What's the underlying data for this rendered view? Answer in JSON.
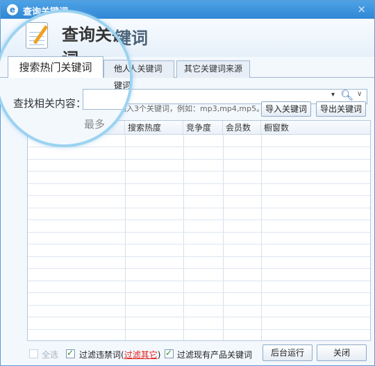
{
  "window": {
    "title": "查询关键词",
    "close_glyph": "×",
    "header_title": "查询关键词"
  },
  "tabs": [
    {
      "label": "搜索热门关键词",
      "active": true
    },
    {
      "label": "他人关键词",
      "active": false
    },
    {
      "label": "其它关键词来源",
      "active": false
    }
  ],
  "search": {
    "label": "查找相关内容：",
    "input_value": "",
    "hint": "输入3个关键词，例如：mp3,mp4,mp5。",
    "max_hint": "最多",
    "dropdown_glyph": "▾",
    "search_icon": "search-icon",
    "chevron_icon": "chevron-down-icon"
  },
  "buttons": {
    "import": "导入关键词",
    "export": "导出关键词",
    "background_run": "后台运行",
    "close": "关闭"
  },
  "table": {
    "columns": [
      "",
      "搜索热度",
      "竞争度",
      "会员数",
      "橱窗数"
    ],
    "rows": []
  },
  "footer": {
    "select_all": "全选",
    "filter_banned": "过滤违禁词(",
    "filter_other_link": "过滤其它",
    "filter_banned_close": ")",
    "filter_existing": "过滤现有产品关键词"
  },
  "colors": {
    "titlebar": "#2f86d4",
    "link_red": "#e3211b",
    "check_green": "#2a8a2a"
  }
}
